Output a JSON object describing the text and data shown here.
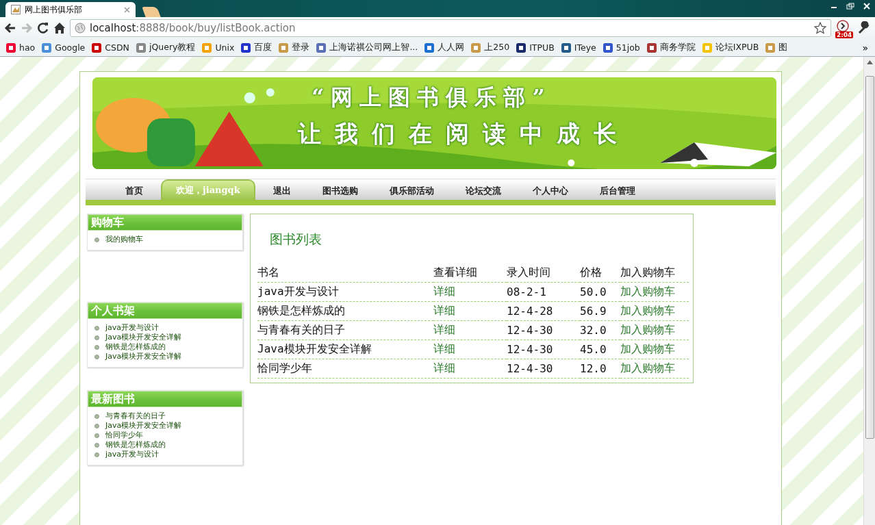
{
  "browser": {
    "tabs": [
      {
        "title": "网上图书俱乐部",
        "selected": true
      }
    ],
    "address": {
      "host": "localhost",
      "path": ":8888/book/buy/listBook.action"
    },
    "extension_badge": "2:04",
    "bookmarks": [
      {
        "label": "hao"
      },
      {
        "label": "Google"
      },
      {
        "label": "CSDN"
      },
      {
        "label": "jQuery教程"
      },
      {
        "label": "Unix"
      },
      {
        "label": "百度"
      },
      {
        "label": "登录"
      },
      {
        "label": "上海诺祺公司网上智..."
      },
      {
        "label": "人人网"
      },
      {
        "label": "上250"
      },
      {
        "label": "ITPUB"
      },
      {
        "label": "ITeye"
      },
      {
        "label": "51job"
      },
      {
        "label": "商务学院"
      },
      {
        "label": "论坛IXPUB"
      },
      {
        "label": "图"
      }
    ],
    "bookmarks_overflow": "»"
  },
  "banner": {
    "title": "“网上图书俱乐部”",
    "slogan": "让我们在阅读中成长"
  },
  "nav": [
    {
      "label": "首页",
      "selected": false
    },
    {
      "label": "欢迎，jiangqk",
      "selected": true
    },
    {
      "label": "退出",
      "selected": false
    },
    {
      "label": "图书选购",
      "selected": false
    },
    {
      "label": "俱乐部活动",
      "selected": false
    },
    {
      "label": "论坛交流",
      "selected": false
    },
    {
      "label": "个人中心",
      "selected": false
    },
    {
      "label": "后台管理",
      "selected": false
    }
  ],
  "sidebar": [
    {
      "title": "购物车",
      "items": [
        "我的购物车"
      ]
    },
    {
      "title": "个人书架",
      "items": [
        "java开发与设计",
        "Java模块开发安全详解",
        "钢铁是怎样炼成的",
        "Java模块开发安全详解"
      ]
    },
    {
      "title": "最新图书",
      "items": [
        "与青春有关的日子",
        "Java模块开发安全详解",
        "恰同学少年",
        "钢铁是怎样炼成的",
        "java开发与设计"
      ]
    }
  ],
  "book_list": {
    "title": "图书列表",
    "columns": [
      "书名",
      "查看详细",
      "录入时间",
      "价格",
      "加入购物车"
    ],
    "rows": [
      [
        "java开发与设计",
        "详细",
        "08-2-1",
        "50.0",
        "加入购物车"
      ],
      [
        "钢铁是怎样炼成的",
        "详细",
        "12-4-28",
        "56.9",
        "加入购物车"
      ],
      [
        "与青春有关的日子",
        "详细",
        "12-4-30",
        "32.0",
        "加入购物车"
      ],
      [
        "Java模块开发安全详解",
        "详细",
        "12-4-30",
        "45.0",
        "加入购物车"
      ],
      [
        "恰同学少年",
        "详细",
        "12-4-30",
        "12.0",
        "加入购物车"
      ]
    ]
  }
}
